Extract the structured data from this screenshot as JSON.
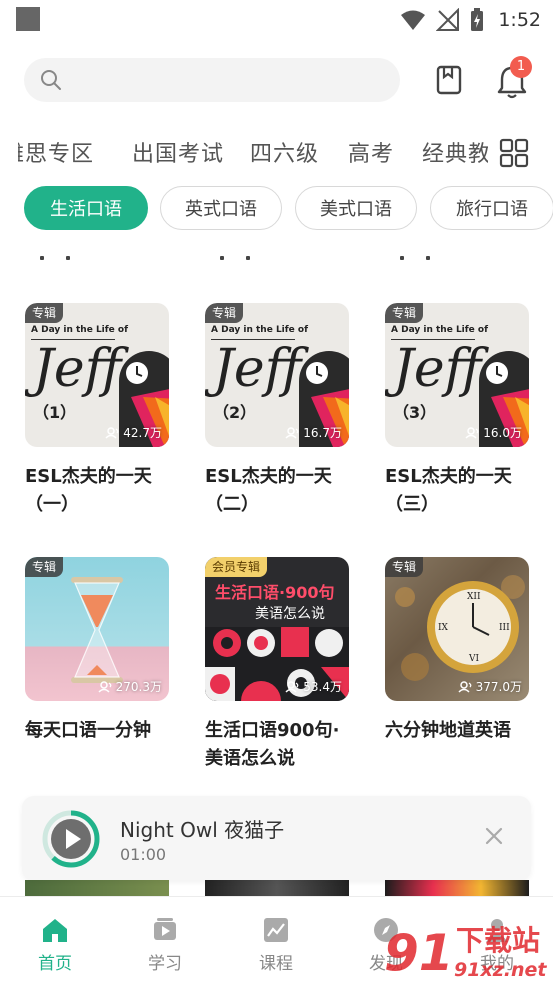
{
  "status": {
    "time": "1:52"
  },
  "search": {
    "placeholder": ""
  },
  "header": {
    "notification_count": "1"
  },
  "categories": [
    "雅思专区",
    "出国考试",
    "四六级",
    "高考",
    "经典教"
  ],
  "chips": [
    "生活口语",
    "英式口语",
    "美式口语",
    "旅行口语"
  ],
  "cards": [
    {
      "tag": "专辑",
      "cover_small": "A Day in the Life of",
      "cover_big": "Jeff",
      "cover_num": "（1）",
      "plays": "42.7万",
      "title": "ESL杰夫的一天（一）"
    },
    {
      "tag": "专辑",
      "cover_small": "A Day in the Life of",
      "cover_big": "Jeff",
      "cover_num": "（2）",
      "plays": "16.7万",
      "title": "ESL杰夫的一天（二）"
    },
    {
      "tag": "专辑",
      "cover_small": "A Day in the Life of",
      "cover_big": "Jeff",
      "cover_num": "（3）",
      "plays": "16.0万",
      "title": "ESL杰夫的一天（三）"
    },
    {
      "tag": "专辑",
      "plays": "270.3万",
      "title": "每天口语一分钟"
    },
    {
      "tag": "会员专辑",
      "cover_line1": "生活口语·900句",
      "cover_line2": "美语怎么说",
      "plays": "53.4万",
      "title": "生活口语900句·美语怎么说"
    },
    {
      "tag": "专辑",
      "plays": "377.0万",
      "title": "六分钟地道英语"
    }
  ],
  "player": {
    "title": "Night Owl 夜猫子",
    "time": "01:00",
    "progress": 0.62
  },
  "tabs": [
    {
      "label": "首页",
      "active": true
    },
    {
      "label": "学习"
    },
    {
      "label": "课程"
    },
    {
      "label": "发现"
    },
    {
      "label": "我的"
    }
  ],
  "watermark": {
    "text": "下载站",
    "url": "91xz.net",
    "digits": "91"
  },
  "colors": {
    "accent": "#21b28a",
    "badge": "#f25c4f",
    "watermark": "#e0282e"
  }
}
